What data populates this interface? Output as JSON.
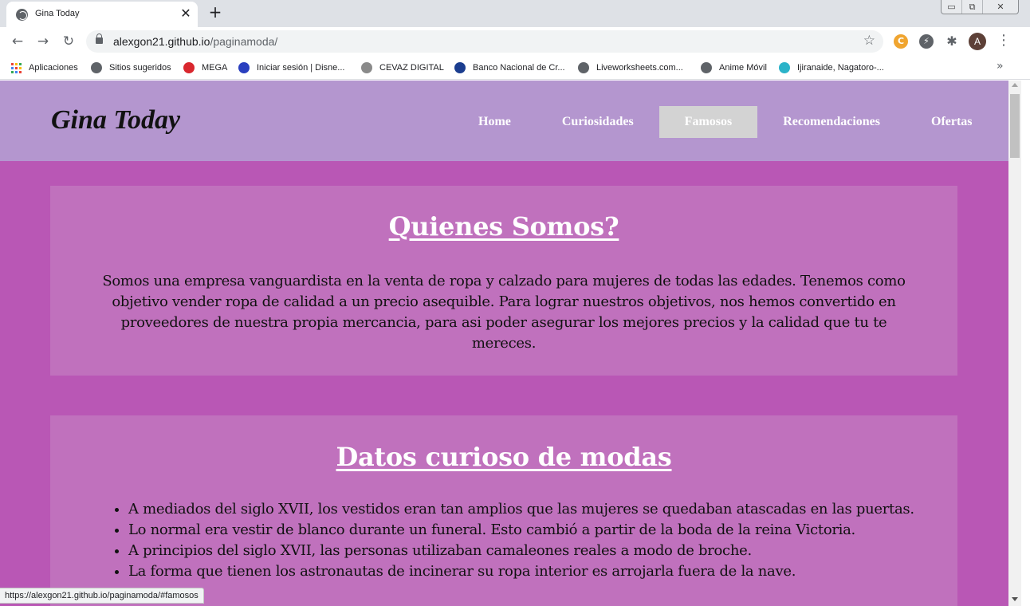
{
  "browser": {
    "tab_title": "Gina Today",
    "tab_close": "✕",
    "new_tab": "+",
    "window_controls": [
      "▭",
      "⧉",
      "✕"
    ],
    "url_host": "alexgon21.github.io",
    "url_path": "/paginamoda/",
    "nav_back": "←",
    "nav_forward": "→",
    "nav_reload": "↻",
    "star": "☆",
    "avatar_initial": "A",
    "menu": "⋮",
    "extensions": [
      {
        "icon": "coin-extension-icon",
        "color": "#f0a530",
        "glyph": "C"
      },
      {
        "icon": "bolt-extension-icon",
        "color": "#5f6368",
        "glyph": "⚡"
      },
      {
        "icon": "puzzle-extension-icon",
        "color": "#5f6368",
        "glyph": "✱"
      }
    ],
    "bookmarks": [
      {
        "label": "Aplicaciones",
        "icon": "apps-grid-icon"
      },
      {
        "label": "Sitios sugeridos",
        "icon": "globe-icon",
        "color": "#5f6368"
      },
      {
        "label": "MEGA",
        "icon": "mega-icon",
        "color": "#d9272e"
      },
      {
        "label": "Iniciar sesión | Disne...",
        "icon": "disney-icon",
        "color": "#2a3fbf"
      },
      {
        "label": "CEVAZ DIGITAL",
        "icon": "cevaz-icon",
        "color": "#8a8a8a"
      },
      {
        "label": "Banco Nacional de Cr...",
        "icon": "bnc-icon",
        "color": "#1b3d8f"
      },
      {
        "label": "Liveworksheets.com...",
        "icon": "globe-icon",
        "color": "#5f6368"
      },
      {
        "label": "Anime Móvil",
        "icon": "globe-icon",
        "color": "#5f6368"
      },
      {
        "label": "Ijiranaide, Nagatoro-...",
        "icon": "anime-site-icon",
        "color": "#2bb3c9"
      }
    ],
    "bookmarks_more": "»",
    "status_url": "https://alexgon21.github.io/paginamoda/#famosos"
  },
  "site": {
    "logo": "Gina Today",
    "nav": [
      {
        "label": "Home",
        "active": false
      },
      {
        "label": "Curiosidades",
        "active": false
      },
      {
        "label": "Famosos",
        "active": true
      },
      {
        "label": "Recomendaciones",
        "active": false
      },
      {
        "label": "Ofertas",
        "active": false
      }
    ],
    "about": {
      "title": "Quienes Somos?",
      "text": "Somos una empresa vanguardista en la venta de ropa y calzado para mujeres de todas las edades. Tenemos como objetivo vender ropa de calidad a un precio asequible. Para lograr nuestros objetivos, nos hemos convertido en proveedores de nuestra propia mercancia, para asi poder asegurar los mejores precios y la calidad que tu te mereces."
    },
    "facts": {
      "title": "Datos curioso de modas",
      "items": [
        "A mediados del siglo XVII, los vestidos eran tan amplios que las mujeres se quedaban atascadas en las puertas.",
        "Lo normal era vestir de blanco durante un funeral. Esto cambió a partir de la boda de la reina Victoria.",
        "A principios del siglo XVII, las personas utilizaban camaleones reales a modo de broche.",
        "La forma que tienen los astronautas de incinerar su ropa interior es arrojarla fuera de la nave."
      ]
    }
  },
  "colors": {
    "page_bg": "#b957b5",
    "header_bg": "#b496cf",
    "card_bg": "#c071bd",
    "active_nav_bg": "#d3d3d3"
  }
}
